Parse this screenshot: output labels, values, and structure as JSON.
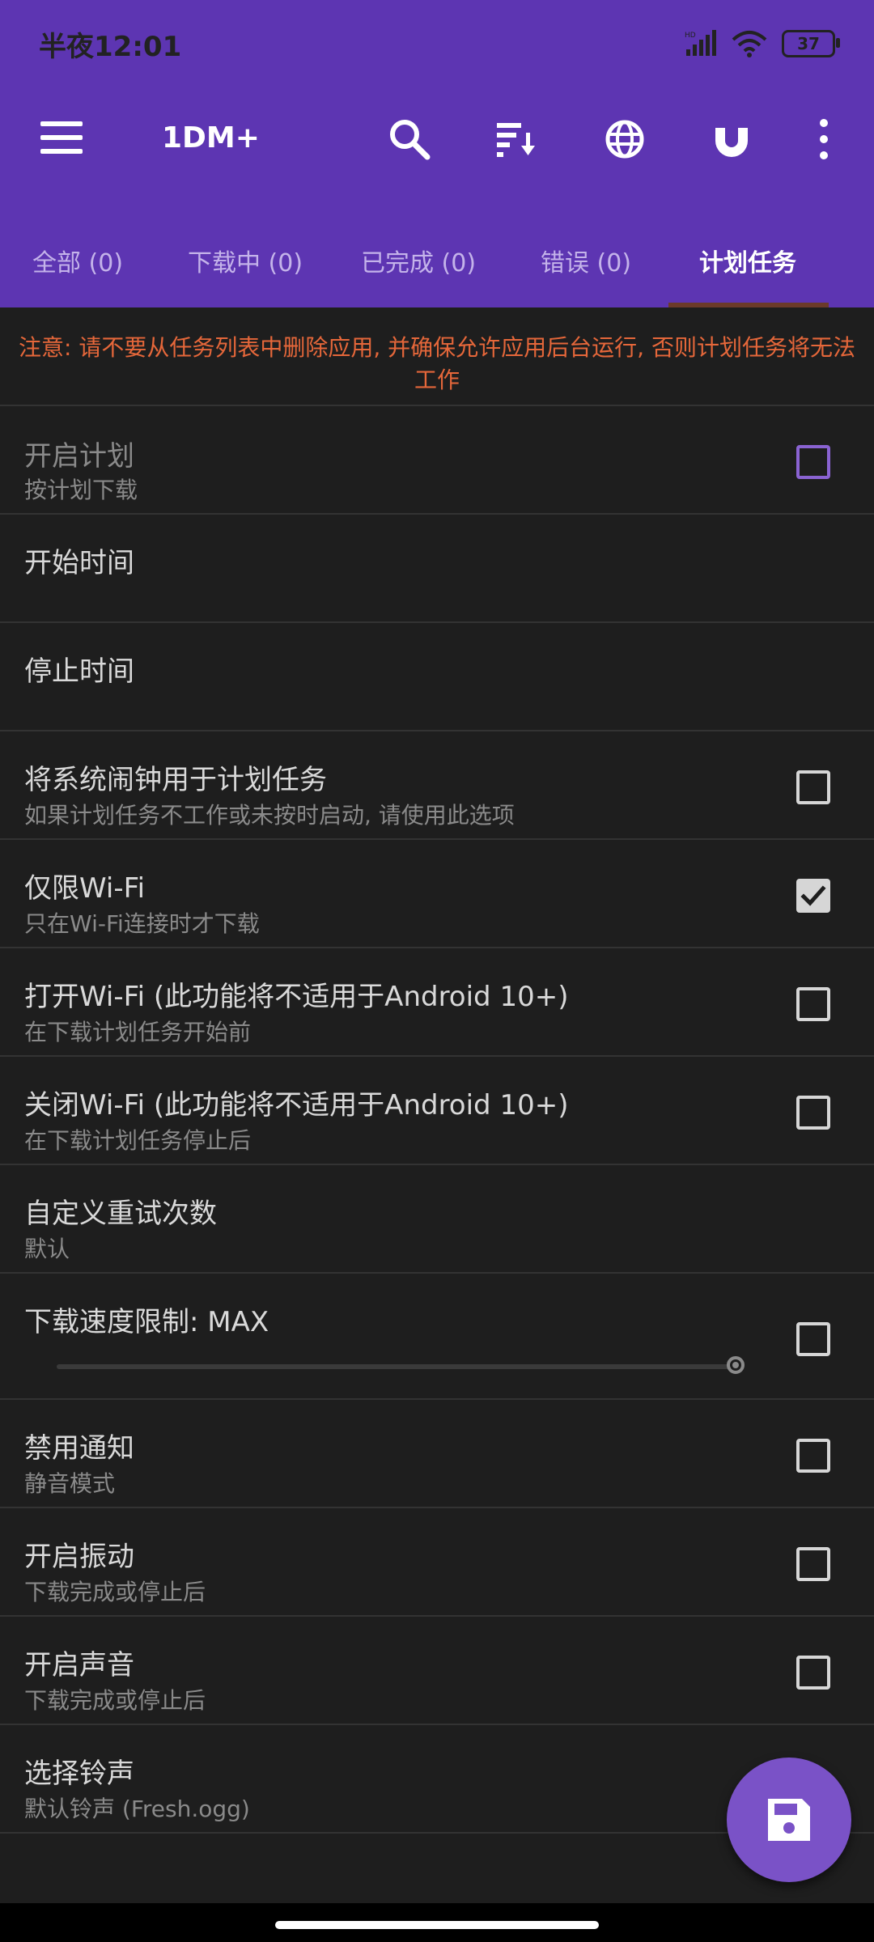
{
  "status_bar": {
    "time": "半夜12:01",
    "battery": "37"
  },
  "toolbar": {
    "title": "1DM+"
  },
  "tabs": [
    {
      "label": "全部 (0)"
    },
    {
      "label": "下载中 (0)"
    },
    {
      "label": "已完成 (0)"
    },
    {
      "label": "错误 (0)"
    },
    {
      "label": "计划任务",
      "active": true
    }
  ],
  "notice": "注意: 请不要从任务列表中删除应用, 并确保允许应用后台运行, 否则计划任务将无法工作",
  "settings": [
    {
      "title": "开启计划",
      "subtitle": "按计划下载",
      "checkbox": "unchecked",
      "disabled": true
    },
    {
      "title": "开始时间",
      "subtitle": ""
    },
    {
      "title": "停止时间",
      "subtitle": ""
    },
    {
      "title": "将系统闹钟用于计划任务",
      "subtitle": "如果计划任务不工作或未按时启动, 请使用此选项",
      "checkbox": "unchecked"
    },
    {
      "title": "仅限Wi-Fi",
      "subtitle": "只在Wi-Fi连接时才下载",
      "checkbox": "checked"
    },
    {
      "title": "打开Wi-Fi (此功能将不适用于Android 10+)",
      "subtitle": "在下载计划任务开始前",
      "checkbox": "unchecked"
    },
    {
      "title": "关闭Wi-Fi (此功能将不适用于Android 10+)",
      "subtitle": "在下载计划任务停止后",
      "checkbox": "unchecked"
    },
    {
      "title": "自定义重试次数",
      "subtitle": "默认"
    },
    {
      "title": "下载速度限制: MAX",
      "slider_value": "MAX",
      "checkbox": "unchecked"
    },
    {
      "title": "禁用通知",
      "subtitle": "静音模式",
      "checkbox": "unchecked"
    },
    {
      "title": "开启振动",
      "subtitle": "下载完成或停止后",
      "checkbox": "unchecked"
    },
    {
      "title": "开启声音",
      "subtitle": "下载完成或停止后",
      "checkbox": "unchecked"
    },
    {
      "title": "选择铃声",
      "subtitle": "默认铃声 (Fresh.ogg)"
    }
  ],
  "colors": {
    "accent": "#5d35b2",
    "fab": "#7a52c7",
    "notice": "#e5673a",
    "background": "#1e1e1e"
  },
  "icons": [
    "menu-icon",
    "search-icon",
    "sort-icon",
    "browser-icon",
    "magnet-icon",
    "more-vert-icon",
    "save-icon",
    "signal-icon",
    "wifi-icon",
    "battery-icon"
  ]
}
